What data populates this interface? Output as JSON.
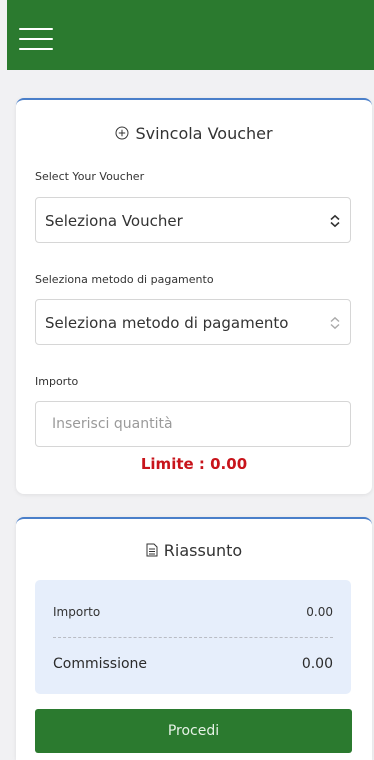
{
  "header": {
    "menu_icon": "hamburger-menu-icon",
    "color": "#2b7a2f"
  },
  "release_card": {
    "title": "Svincola Voucher",
    "title_icon": "plus-circle-icon",
    "voucher_label": "Select Your Voucher",
    "voucher_value": "Seleziona Voucher",
    "payment_label": "Seleziona metodo di pagamento",
    "payment_value": "Seleziona metodo di pagamento",
    "amount_label": "Importo",
    "amount_placeholder": "Inserisci quantità",
    "limit_text": "Limite : 0.00",
    "limit_color": "#c8141b"
  },
  "summary_card": {
    "title": "Riassunto",
    "title_icon": "document-icon",
    "rows": [
      {
        "label": "Importo",
        "value": "0.00"
      },
      {
        "label": "Commissione",
        "value": "0.00"
      }
    ],
    "proceed_label": "Procedi"
  },
  "colors": {
    "accent_border": "#4a7fc9",
    "summary_background": "#e6eefb",
    "button": "#2b7a2f"
  }
}
